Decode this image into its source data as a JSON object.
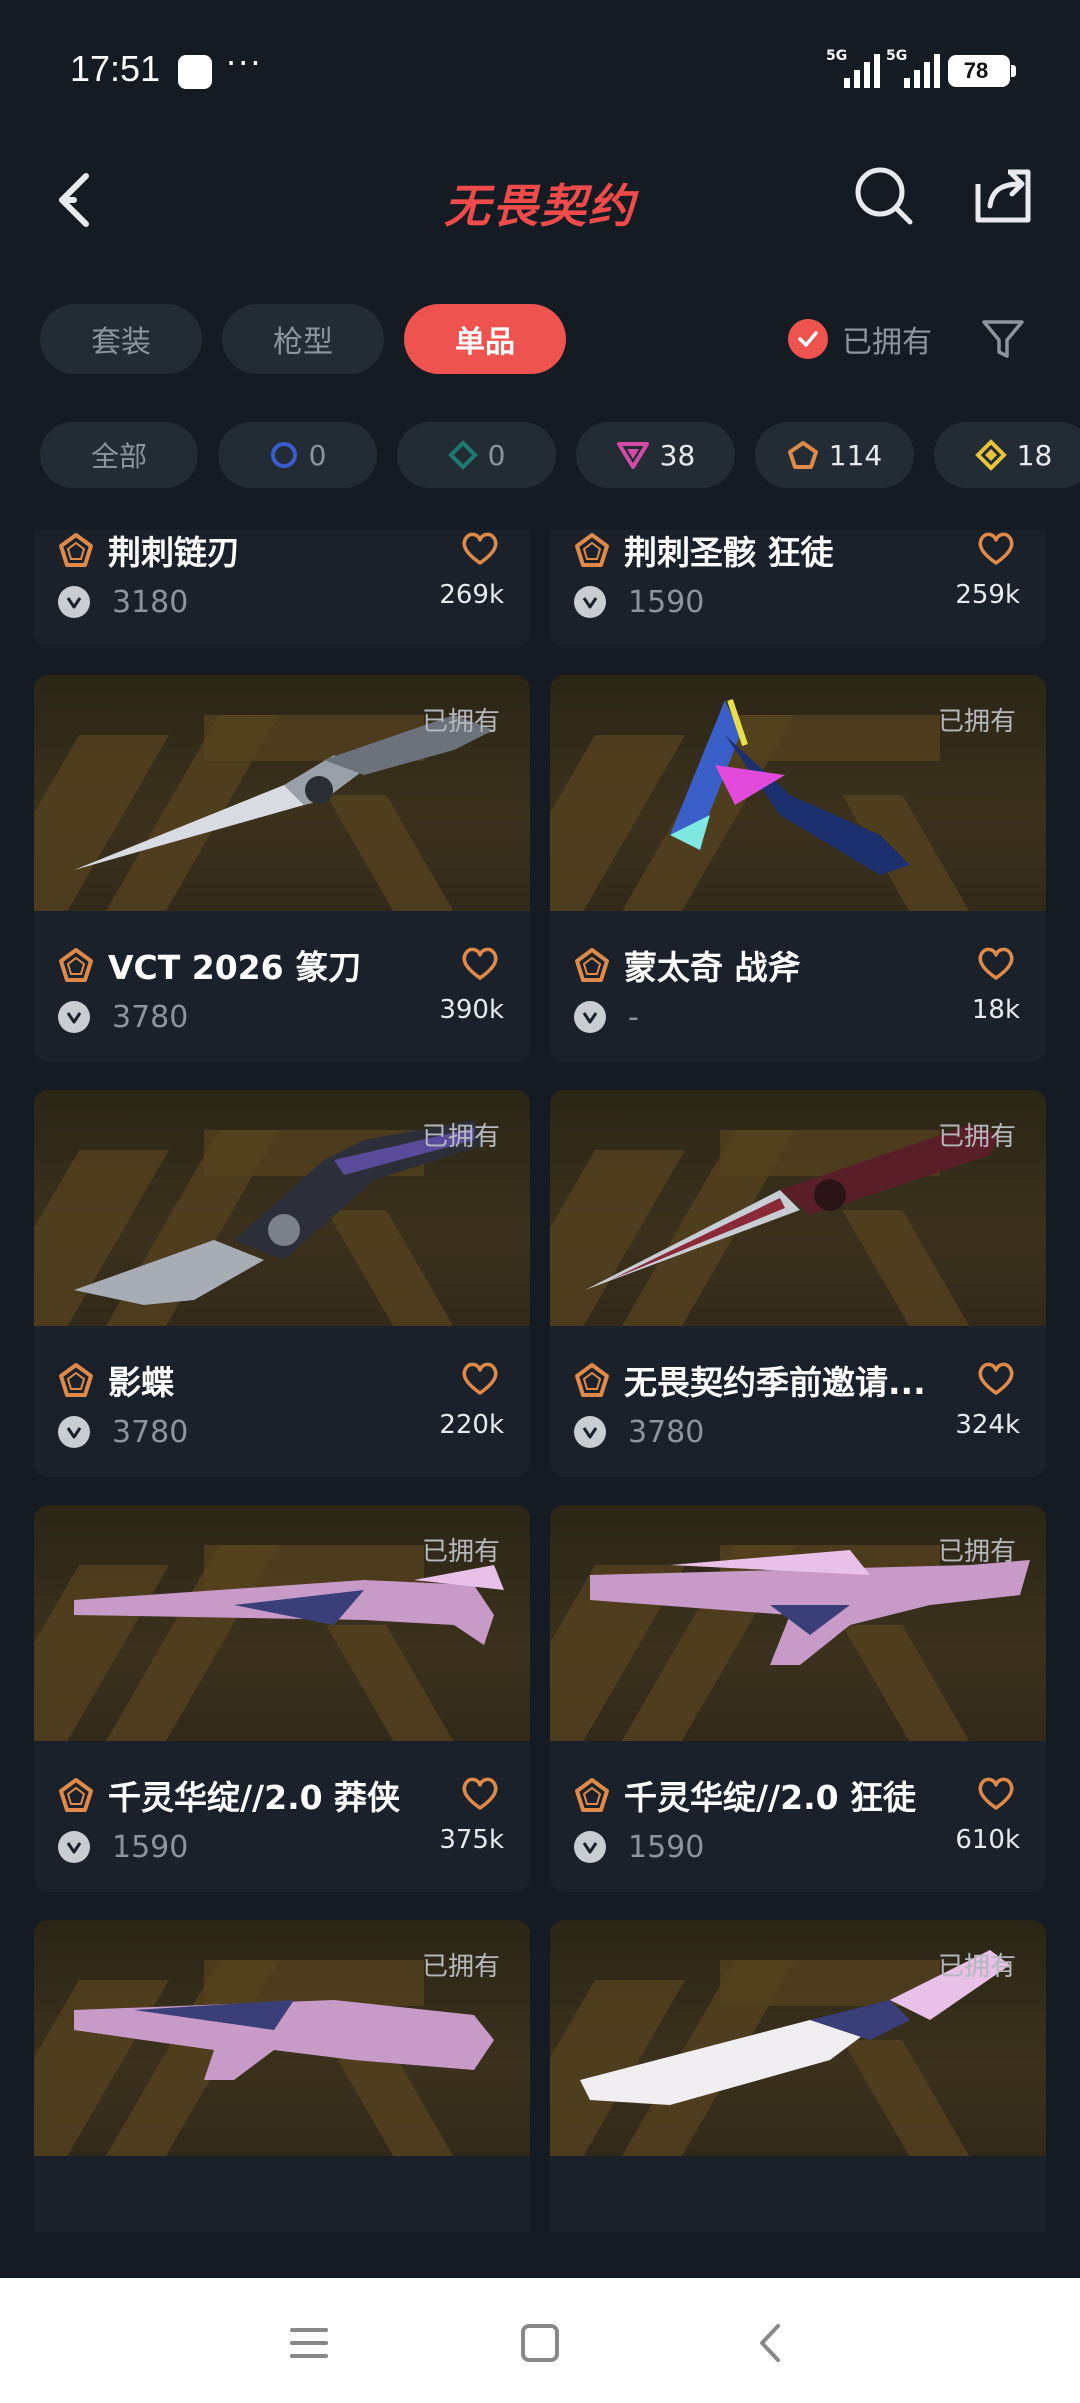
{
  "status_bar": {
    "time": "17:51",
    "dots": "···",
    "network_1": "5G",
    "network_2": "5G",
    "battery": "78"
  },
  "header": {
    "title": "无畏契约"
  },
  "tabs": [
    {
      "label": "套装",
      "active": false
    },
    {
      "label": "枪型",
      "active": false
    },
    {
      "label": "单品",
      "active": true
    }
  ],
  "owned_filter": {
    "label": "已拥有",
    "checked": true
  },
  "rarity_chips": [
    {
      "label": "全部"
    },
    {
      "value": "0",
      "icon": "select-tier-icon",
      "color": "#3b5ccc"
    },
    {
      "value": "0",
      "icon": "deluxe-tier-icon",
      "color": "#1d7a6e"
    },
    {
      "value": "38",
      "icon": "premium-tier-icon",
      "color": "#d24ca6"
    },
    {
      "value": "114",
      "icon": "exclusive-tier-icon",
      "color": "#e08a4a"
    },
    {
      "value": "18",
      "icon": "ultra-tier-icon",
      "color": "#e8c43a"
    }
  ],
  "cards": [
    {
      "name": "荆刺链刃",
      "price": "3180",
      "likes": "269k",
      "owned": "",
      "art": "knife-a"
    },
    {
      "name": "荆刺圣骸 狂徒",
      "price": "1590",
      "likes": "259k",
      "owned": "",
      "art": "rifle-a"
    },
    {
      "name": "VCT 2026 篆刀",
      "price": "3780",
      "likes": "390k",
      "owned": "已拥有",
      "art": "dagger"
    },
    {
      "name": "蒙太奇 战斧",
      "price": "-",
      "likes": "18k",
      "owned": "已拥有",
      "art": "axe"
    },
    {
      "name": "影蝶",
      "price": "3780",
      "likes": "220k",
      "owned": "已拥有",
      "art": "butterfly"
    },
    {
      "name": "无畏契约季前邀请...",
      "price": "3780",
      "likes": "324k",
      "owned": "已拥有",
      "art": "switchblade"
    },
    {
      "name": "千灵华绽//2.0 莽侠",
      "price": "1590",
      "likes": "375k",
      "owned": "已拥有",
      "art": "sniper"
    },
    {
      "name": "千灵华绽//2.0 狂徒",
      "price": "1590",
      "likes": "610k",
      "owned": "已拥有",
      "art": "vandal"
    },
    {
      "name": "",
      "price": "",
      "likes": "",
      "owned": "已拥有",
      "art": "phantom"
    },
    {
      "name": "",
      "price": "",
      "likes": "",
      "owned": "已拥有",
      "art": "blade"
    }
  ],
  "colors": {
    "accent": "#ee5350",
    "title": "#ef4b4b",
    "bg": "#151b23",
    "card_bg": "#1a212a",
    "exclusive": "#e08a4a"
  }
}
